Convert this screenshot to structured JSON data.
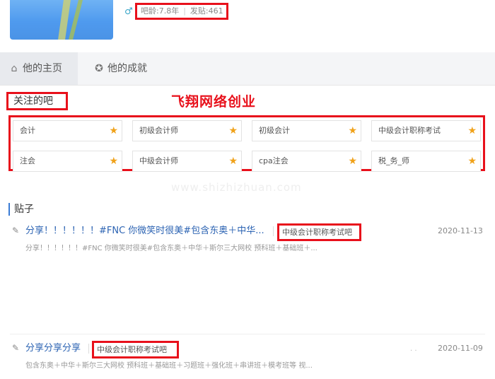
{
  "profile": {
    "stats": {
      "age_label": "吧龄:7.8年",
      "posts_label": "发贴:461"
    },
    "gender_icon": "male-icon"
  },
  "tabs": [
    {
      "label": "他的主页",
      "icon": "home-icon",
      "active": true
    },
    {
      "label": "他的成就",
      "icon": "medal-icon",
      "active": false
    }
  ],
  "followed": {
    "title": "关注的吧",
    "overlay_title": "飞翔网络创业",
    "bars": [
      {
        "name": "会计"
      },
      {
        "name": "初级会计师"
      },
      {
        "name": "初级会计"
      },
      {
        "name": "中级会计职称考试"
      },
      {
        "name": "注会"
      },
      {
        "name": "中级会计师"
      },
      {
        "name": "cpa注会"
      },
      {
        "name": "税_务_师"
      }
    ],
    "star_icon": "star-icon",
    "star_color": "#f0a21a"
  },
  "watermark": "www.shizhizhuan.com",
  "posts": {
    "title": "贴子",
    "items": [
      {
        "title": "分享！！！！！！#FNC 你微笑时很美#包含东奥＋中华...",
        "tag": "中级会计职称考试吧",
        "date": "2020-11-13",
        "excerpt": "分享！！！！！！#FNC 你微笑时很美#包含东奥＋中华＋斯尔三大网校 预科班＋基础班＋..."
      },
      {
        "title": "分享分享分享",
        "tag": "中级会计职称考试吧",
        "date": "2020-11-09",
        "dots": ". .",
        "excerpt": "包含东奥＋中华＋斯尔三大网校 预科班＋基础班＋习题班＋强化班＋串讲班＋模考班等 视..."
      }
    ]
  },
  "colors": {
    "highlight_border": "#e8101b",
    "link": "#2d64b3"
  }
}
